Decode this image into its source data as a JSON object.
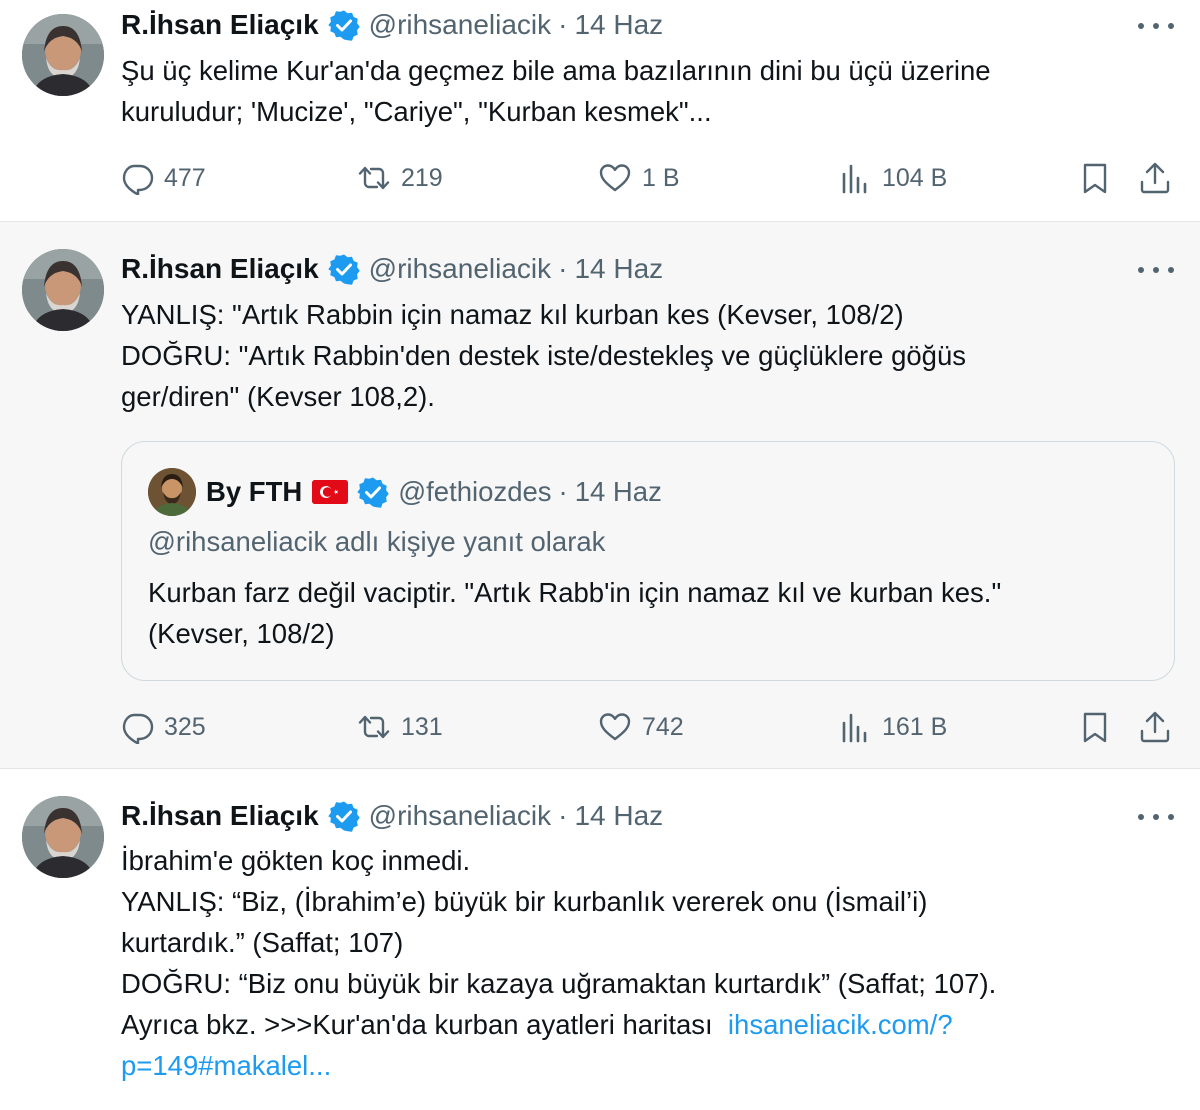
{
  "colors": {
    "accent": "#1d9bf0",
    "muted": "#536471",
    "text": "#0f1419",
    "selected_bg": "#f7f7f7",
    "flag_red": "#e30a17"
  },
  "tweets": [
    {
      "author": "R.İhsan Eliaçık",
      "handle": "@rihsaneliacik",
      "separator": "·",
      "time": "14 Haz",
      "lines": [
        "Şu üç kelime Kur'an'da geçmez bile ama bazılarının dini bu üçü üzerine",
        "kuruludur; 'Mucize', \"Cariye\", \"Kurban kesmek\"..."
      ],
      "stats": {
        "replies": "477",
        "retweets": "219",
        "likes": "1 B",
        "views": "104 B"
      }
    },
    {
      "author": "R.İhsan Eliaçık",
      "handle": "@rihsaneliacik",
      "separator": "·",
      "time": "14 Haz",
      "lines": [
        "YANLIŞ: \"Artık Rabbin için namaz kıl kurban kes (Kevser, 108/2)",
        "DOĞRU: \"Artık Rabbin'den destek iste/destekleş ve güçlüklere göğüs",
        "ger/diren\" (Kevser 108,2)."
      ],
      "quote": {
        "author": "By FTH",
        "handle": "@fethiozdes",
        "separator": "·",
        "time": "14 Haz",
        "reply_to": "@rihsaneliacik adlı kişiye yanıt olarak",
        "lines": [
          "Kurban farz değil vaciptir. \"Artık Rabb'in için namaz kıl ve kurban kes.\"",
          "(Kevser, 108/2)"
        ]
      },
      "stats": {
        "replies": "325",
        "retweets": "131",
        "likes": "742",
        "views": "161 B"
      }
    },
    {
      "author": "R.İhsan Eliaçık",
      "handle": "@rihsaneliacik",
      "separator": "·",
      "time": "14 Haz",
      "lines": [
        "İbrahim'e gökten koç inmedi.",
        "YANLIŞ: “Biz, (İbrahim’e) büyük bir kurbanlık vererek onu (İsmail’i)",
        "kurtardık.” (Saffat; 107)",
        "DOĞRU: “Biz onu büyük bir kazaya uğramaktan kurtardık” (Saffat; 107).",
        "Ayrıca bkz. >>>Kur'an'da kurban ayatleri haritası"
      ],
      "link_part1": "ihsaneliacik.com/?",
      "link_part2": "p=149#makalel..."
    }
  ],
  "icons": {
    "reply": "reply-icon",
    "retweet": "retweet-icon",
    "like": "heart-icon",
    "views": "views-icon",
    "bookmark": "bookmark-icon",
    "share": "share-icon",
    "verified": "verified-badge-icon",
    "more": "more-icon",
    "flag": "turkey-flag-icon"
  }
}
